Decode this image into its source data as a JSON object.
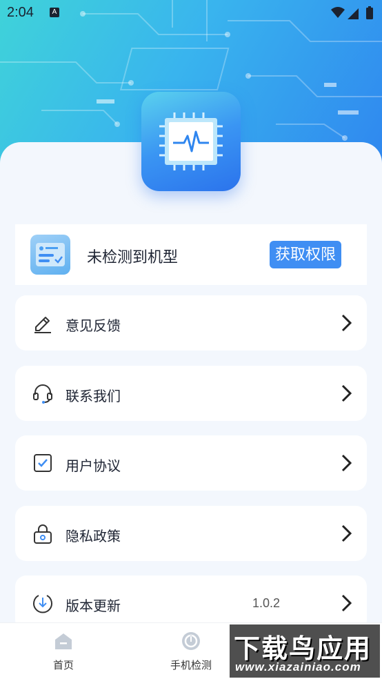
{
  "status_bar": {
    "time": "2:04",
    "notification_badge": "A"
  },
  "device": {
    "status_text": "未检测到机型",
    "permission_button": "获取权限"
  },
  "menu": [
    {
      "label": "意见反馈",
      "icon": "pen-icon"
    },
    {
      "label": "联系我们",
      "icon": "headset-icon"
    },
    {
      "label": "用户协议",
      "icon": "checkbox-icon"
    },
    {
      "label": "隐私政策",
      "icon": "lock-icon"
    },
    {
      "label": "版本更新",
      "icon": "download-icon",
      "value": "1.0.2"
    }
  ],
  "bottom_nav": {
    "home": "首页",
    "phone_check": "手机检测"
  },
  "watermark": {
    "title": "下载鸟应用",
    "url": "www.xiazainiao.com"
  },
  "colors": {
    "accent": "#3f8ef3",
    "background": "#f3f7fd",
    "hero_start": "#3fd3d9",
    "hero_end": "#2f86ef"
  }
}
